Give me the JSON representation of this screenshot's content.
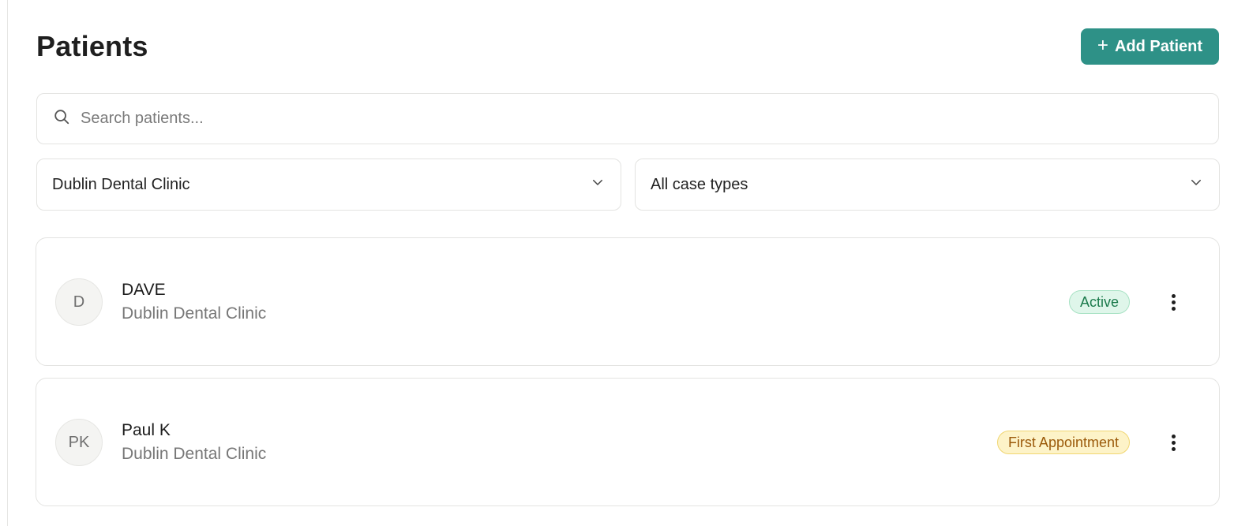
{
  "page": {
    "title": "Patients"
  },
  "header": {
    "add_button_label": "Add Patient",
    "add_button_icon": "plus-icon",
    "accent_color": "#2e9187"
  },
  "search": {
    "placeholder": "Search patients...",
    "value": "",
    "icon": "search-icon"
  },
  "filters": {
    "clinic": {
      "selected": "Dublin Dental Clinic",
      "icon": "chevron-down-icon"
    },
    "case_type": {
      "selected": "All case types",
      "icon": "chevron-down-icon"
    }
  },
  "patients": [
    {
      "initials": "D",
      "name": "DAVE",
      "clinic": "Dublin Dental Clinic",
      "status": "Active",
      "status_color": "#1a7a4b"
    },
    {
      "initials": "PK",
      "name": "Paul K",
      "clinic": "Dublin Dental Clinic",
      "status": "First Appointment",
      "status_color": "#9b5a0a"
    }
  ]
}
